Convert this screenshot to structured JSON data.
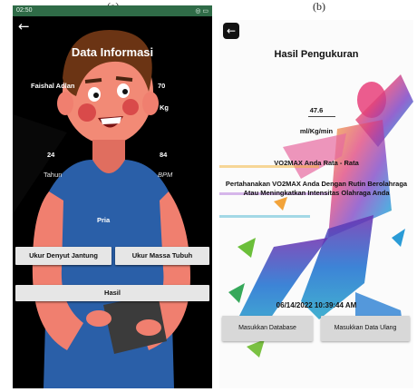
{
  "figure_labels": {
    "a": "(a)",
    "b": "(b)"
  },
  "screen_a": {
    "status_bar": {
      "time": "02:50",
      "right": "◎ ▭"
    },
    "title": "Data Informasi",
    "name": "Faishal Adlan",
    "weight_value": "70",
    "weight_unit": "Kg",
    "age_value": "24",
    "age_unit": "Tahun",
    "bpm_value": "84",
    "bpm_unit": "BPM",
    "gender": "Pria",
    "buttons": {
      "heart_rate": "Ukur Denyut Jantung",
      "body_mass": "Ukur Massa Tubuh",
      "result": "Hasil"
    }
  },
  "screen_b": {
    "title": "Hasil Pengukuran",
    "vo2_value": "47.6",
    "vo2_unit": "ml/Kg/min",
    "vo2_category": "VO2MAX Anda Rata - Rata",
    "advice": "Pertahanakan VO2MAX Anda Dengan Rutin Berolahraga Atau Meningkatkan Intensitas Olahraga Anda",
    "timestamp": "06/14/2022 10:39:44 AM",
    "buttons": {
      "database": "Masukkan Database",
      "redo": "Masukkan Data Ulang"
    }
  },
  "colors": {
    "status_bar": "#2f6b47",
    "shirt": "#2a5fa8",
    "skin": "#f07f6f"
  }
}
